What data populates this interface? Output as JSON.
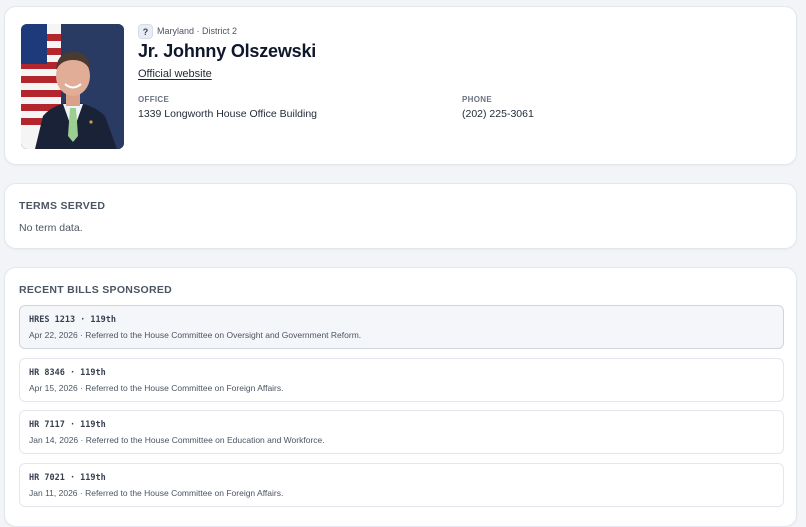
{
  "profile": {
    "party_badge": "?",
    "district": "Maryland · District 2",
    "name": "Jr. Johnny Olszewski",
    "website_label": "Official website",
    "office_label": "OFFICE",
    "office_value": "1339 Longworth House Office Building",
    "phone_label": "PHONE",
    "phone_value": "(202) 225-3061",
    "photo_alt": "portrait-photo"
  },
  "terms": {
    "title": "TERMS SERVED",
    "empty_message": "No term data."
  },
  "bills": {
    "title": "RECENT BILLS SPONSORED",
    "items": [
      {
        "id": "HRES 1213 · 119th",
        "status": "Apr 22, 2026 · Referred to the House Committee on Oversight and Government Reform."
      },
      {
        "id": "HR 8346 · 119th",
        "status": "Apr 15, 2026 · Referred to the House Committee on Foreign Affairs."
      },
      {
        "id": "HR 7117 · 119th",
        "status": "Jan 14, 2026 · Referred to the House Committee on Education and Workforce."
      },
      {
        "id": "HR 7021 · 119th",
        "status": "Jan 11, 2026 · Referred to the House Committee on Foreign Affairs."
      }
    ]
  },
  "colors": {
    "background": "#f2f4f7",
    "card": "#ffffff",
    "border": "#e3e7ee",
    "text_primary": "#0f172a",
    "text_muted": "#4b5563"
  }
}
